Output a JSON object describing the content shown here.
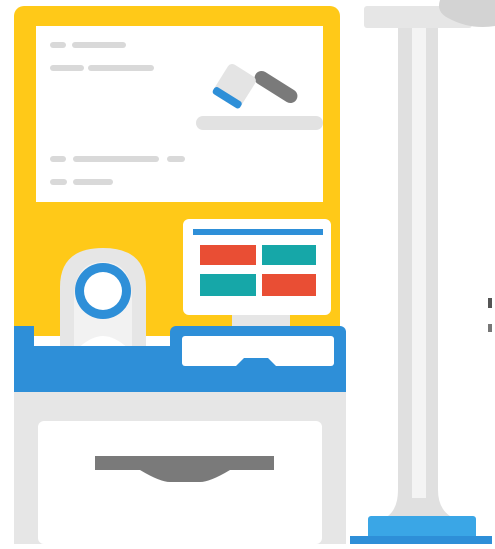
{
  "illustration": {
    "subject": "",
    "colors": {
      "yellow": "#FFC918",
      "white": "#FFFFFF",
      "grey_light": "#E6E6E6",
      "grey_mid": "#D3D3D3",
      "grey_dark": "#7A7A7A",
      "blue": "#2E8FD8",
      "blue_light": "#3AA6E6",
      "red": "#E94E34",
      "teal": "#16A7A8"
    },
    "icons": [
      "gavel-icon",
      "badge-reader-icon",
      "monitor-icon",
      "keyboard-icon",
      "drawer-handle-icon",
      "stanchion-icon",
      "speech-bubble-icon"
    ]
  }
}
